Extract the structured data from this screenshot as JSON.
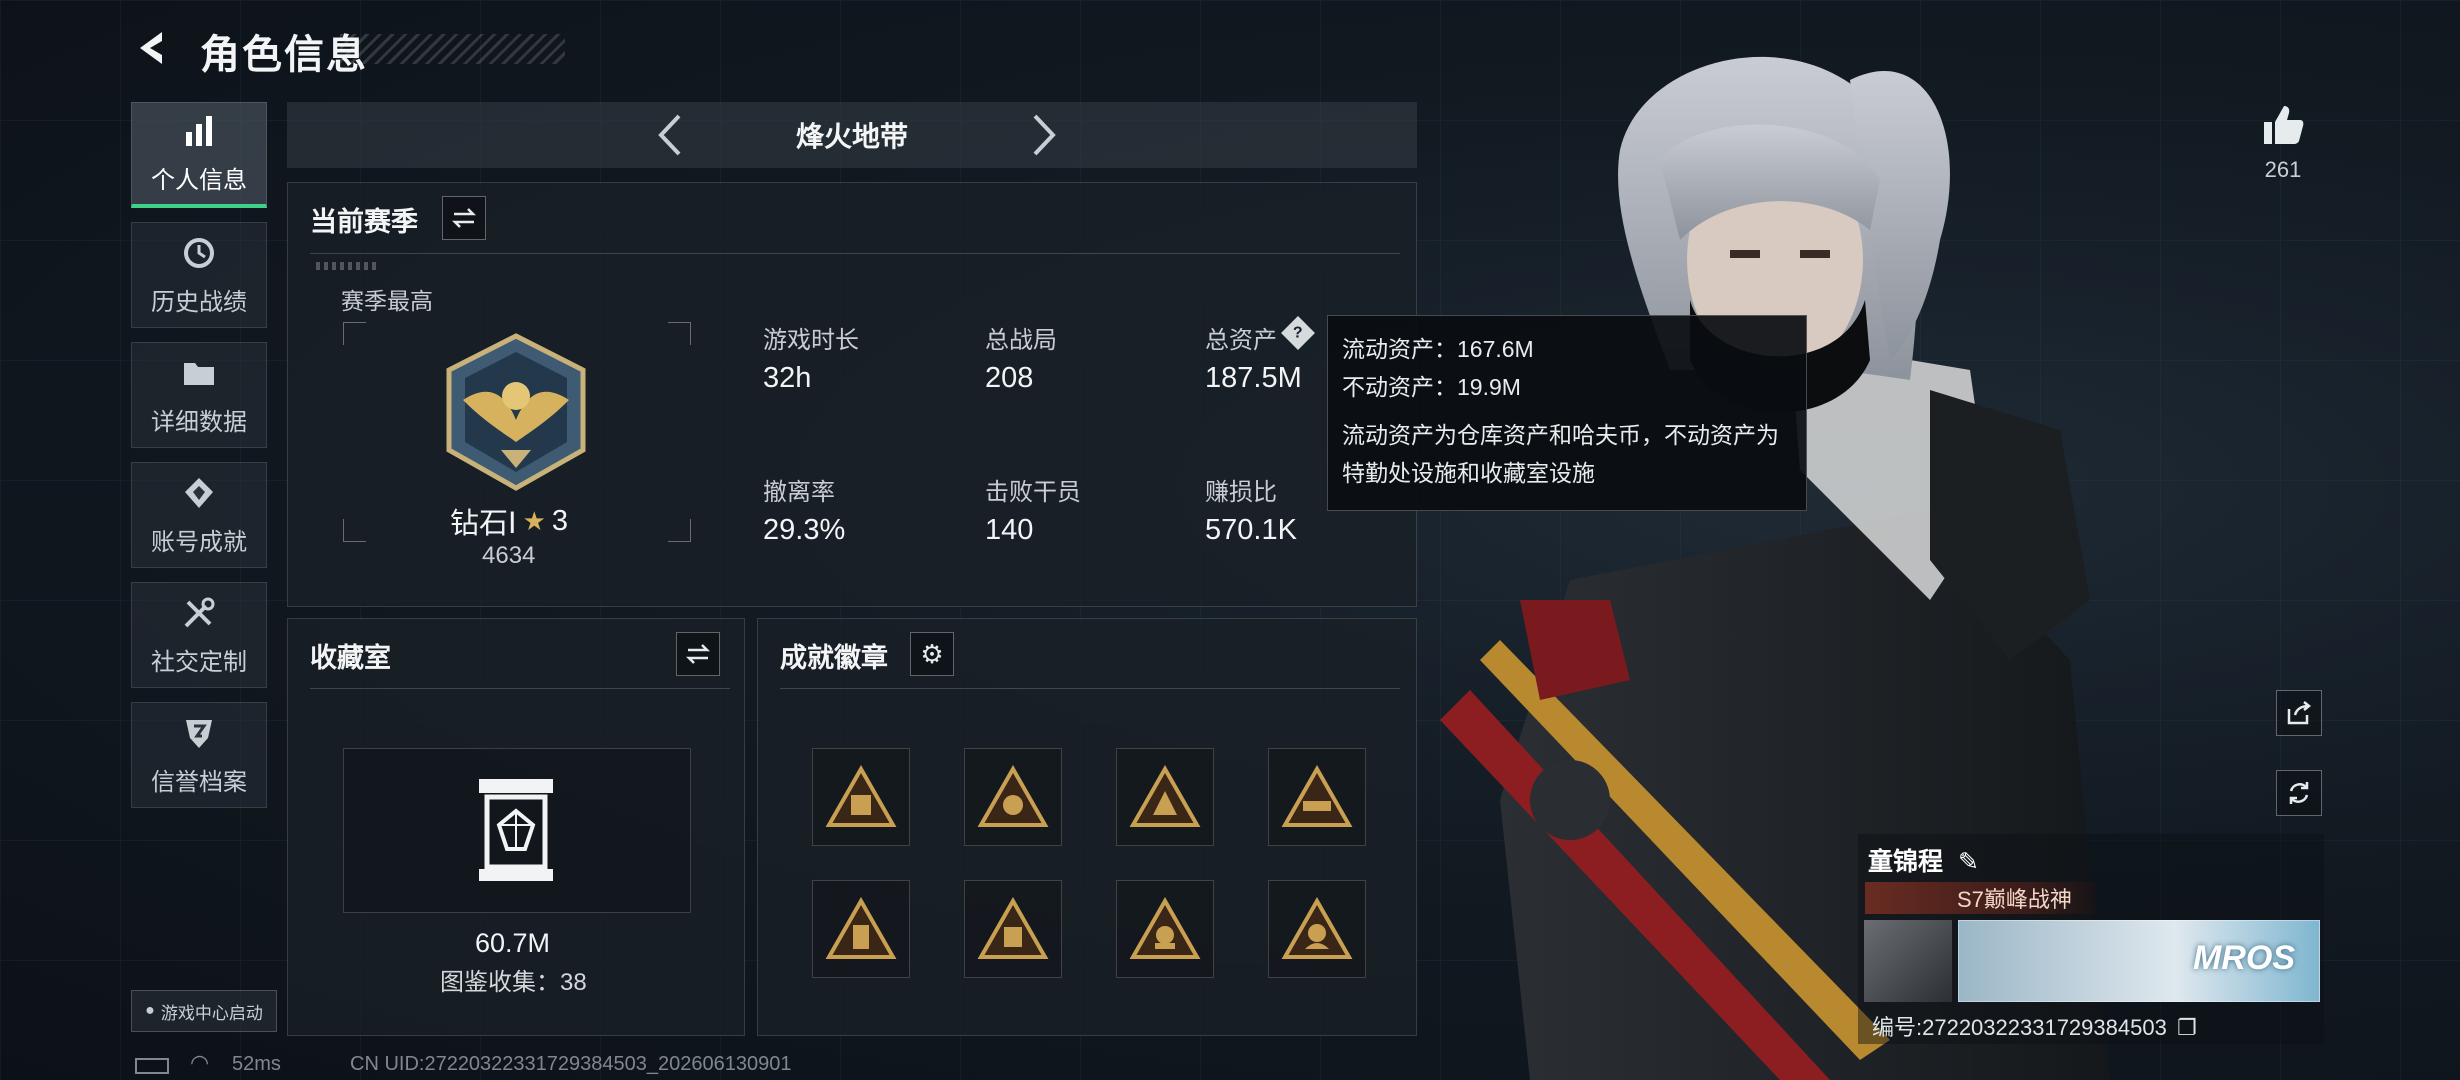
{
  "header": {
    "title": "角色信息"
  },
  "nav": {
    "items": [
      {
        "label": "个人信息",
        "icon": "bar-chart-icon",
        "active": true
      },
      {
        "label": "历史战绩",
        "icon": "history-icon",
        "active": false
      },
      {
        "label": "详细数据",
        "icon": "folder-icon",
        "active": false
      },
      {
        "label": "账号成就",
        "icon": "achievement-icon",
        "active": false
      },
      {
        "label": "社交定制",
        "icon": "tools-icon",
        "active": false
      },
      {
        "label": "信誉档案",
        "icon": "shield-icon",
        "active": false
      }
    ],
    "launch_label": "游戏中心启动"
  },
  "mode": {
    "name": "烽火地带"
  },
  "season": {
    "title": "当前赛季",
    "highest_label": "赛季最高",
    "rank_name": "钻石Ⅰ",
    "rank_stars": "3",
    "rank_points": "4634",
    "stats": [
      {
        "label": "游戏时长",
        "value": "32h"
      },
      {
        "label": "总战局",
        "value": "208"
      },
      {
        "label": "总资产",
        "value": "187.5M"
      },
      {
        "label": "撤离率",
        "value": "29.3%"
      },
      {
        "label": "击败干员",
        "value": "140"
      },
      {
        "label": "赚损比",
        "value": "570.1K"
      }
    ]
  },
  "tooltip": {
    "liquid": "流动资产：167.6M",
    "fixed": "不动资产：19.9M",
    "desc": "流动资产为仓库资产和哈夫币，不动资产为特勤处设施和收藏室设施"
  },
  "collection": {
    "title": "收藏室",
    "value": "60.7M",
    "collect_text": "图鉴收集：38"
  },
  "badges": {
    "title": "成就徽章",
    "items": [
      "badge-1",
      "badge-2",
      "badge-3",
      "badge-4",
      "badge-5",
      "badge-6",
      "badge-7",
      "badge-8"
    ]
  },
  "profile": {
    "likes": "261",
    "name": "童锦程",
    "title_badge": "S7巅峰战神",
    "id_text": "编号:272203223317293845​03",
    "card_text": "MROS"
  },
  "status": {
    "ping": "52ms",
    "uid": "CN UID:272203223317293845​03_202606130901"
  },
  "colors": {
    "accent": "#3fd08a",
    "gold": "#c9a052"
  }
}
